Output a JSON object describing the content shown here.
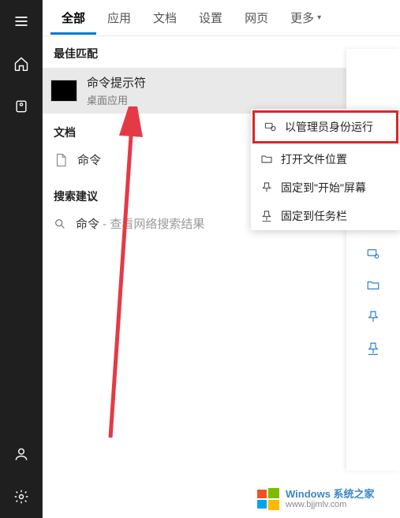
{
  "sidebar": {
    "menu": "menu",
    "home": "home",
    "collection": "collection",
    "user": "user",
    "settings": "settings"
  },
  "tabs": {
    "items": [
      {
        "label": "全部",
        "active": true
      },
      {
        "label": "应用",
        "active": false
      },
      {
        "label": "文档",
        "active": false
      },
      {
        "label": "设置",
        "active": false
      },
      {
        "label": "网页",
        "active": false
      }
    ],
    "more_label": "更多"
  },
  "best_match": {
    "section": "最佳匹配",
    "title": "命令提示符",
    "subtitle": "桌面应用",
    "arrow": "→"
  },
  "docs": {
    "section": "文档",
    "items": [
      {
        "name": "命令"
      }
    ]
  },
  "suggestions": {
    "section": "搜索建议",
    "items": [
      {
        "query": "命令",
        "hint": " - 查看网络搜索结果"
      }
    ]
  },
  "context_menu": {
    "items": [
      {
        "icon": "admin-run",
        "label": "以管理员身份运行",
        "highlight": true
      },
      {
        "icon": "folder",
        "label": "打开文件位置",
        "highlight": false
      },
      {
        "icon": "pin",
        "label": "固定到\"开始\"屏幕",
        "highlight": false
      },
      {
        "icon": "pin-taskbar",
        "label": "固定到任务栏",
        "highlight": false
      }
    ]
  },
  "watermark": {
    "title": "Windows 系统之家",
    "url": "www.bjjmlv.com"
  }
}
